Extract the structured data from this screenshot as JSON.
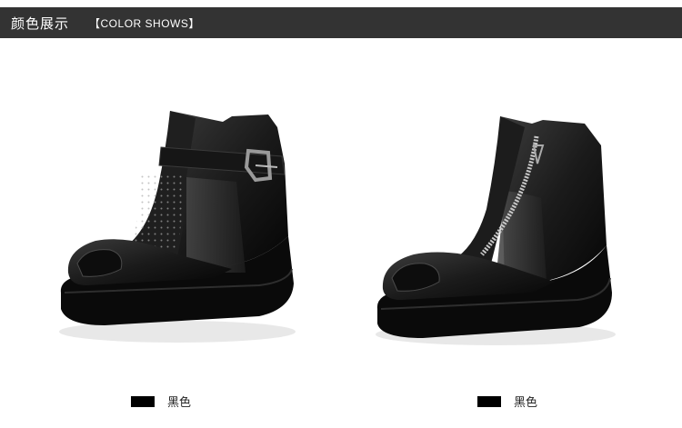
{
  "header": {
    "title_cn": "颜色展示",
    "title_en": "【COLOR SHOWS】",
    "bg_color": "#333333"
  },
  "products": [
    {
      "style": "buckle-strap perforated peep-toe wedge bootie",
      "color_name": "黑色",
      "swatch_color": "#000000"
    },
    {
      "style": "side-zipper mesh peep-toe wedge bootie",
      "color_name": "黑色",
      "swatch_color": "#000000"
    }
  ]
}
